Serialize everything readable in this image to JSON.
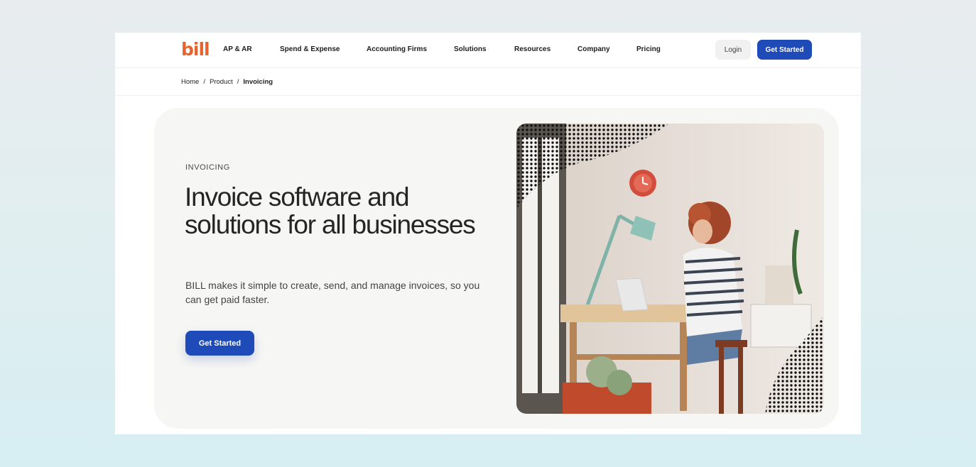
{
  "nav": {
    "logo": "bill",
    "items": [
      {
        "label": "AP & AR"
      },
      {
        "label": "Spend & Expense"
      },
      {
        "label": "Accounting Firms"
      },
      {
        "label": "Solutions"
      },
      {
        "label": "Resources"
      },
      {
        "label": "Company"
      },
      {
        "label": "Pricing"
      }
    ],
    "login_label": "Login",
    "get_started_label": "Get Started"
  },
  "breadcrumb": {
    "items": [
      "Home",
      "Product",
      "Invoicing"
    ],
    "separator": "/"
  },
  "hero": {
    "eyebrow": "INVOICING",
    "headline": "Invoice software and solutions for all businesses",
    "subtext": "BILL makes it simple to create, send, and manage invoices, so you can get paid faster.",
    "cta_label": "Get Started"
  },
  "colors": {
    "brand_orange": "#e8642c",
    "primary_blue": "#1e4bb8",
    "hero_bg": "#f6f6f4"
  }
}
